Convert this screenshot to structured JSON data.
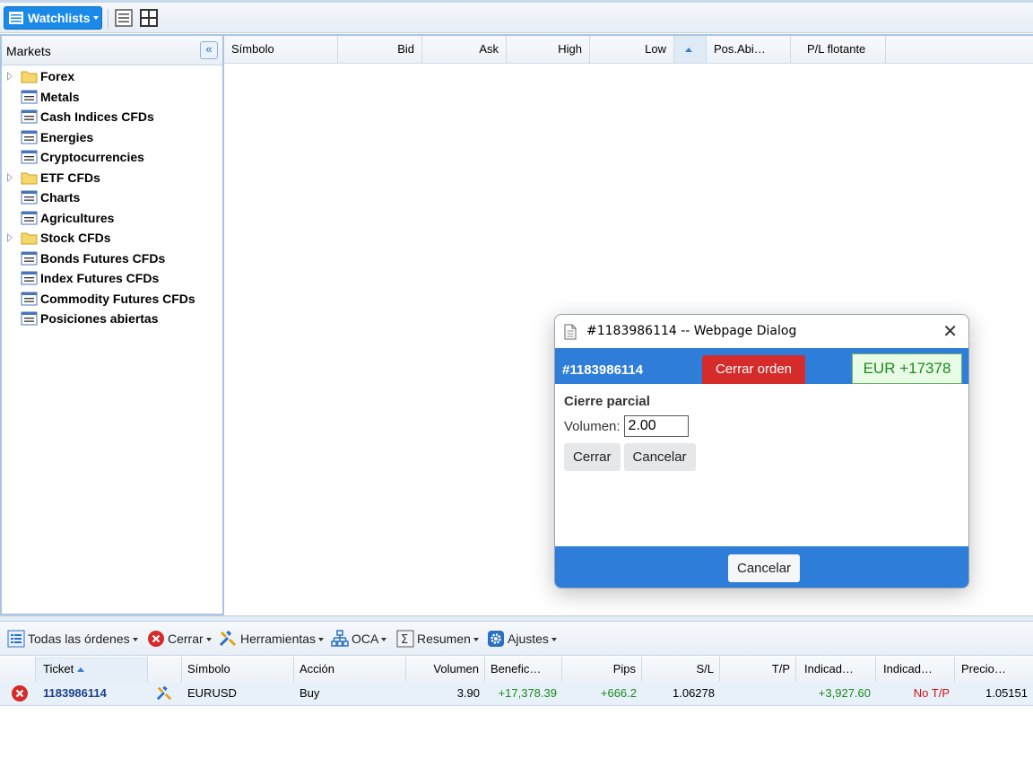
{
  "toolbar": {
    "watchlists_label": "Watchlists",
    "colors": {
      "accent": "#1a8ae8"
    }
  },
  "markets": {
    "title": "Markets",
    "items": [
      {
        "label": "Forex",
        "type": "folder"
      },
      {
        "label": "Metals",
        "type": "list"
      },
      {
        "label": "Cash Indices CFDs",
        "type": "list"
      },
      {
        "label": "Energies",
        "type": "list"
      },
      {
        "label": "Cryptocurrencies",
        "type": "list"
      },
      {
        "label": "ETF CFDs",
        "type": "folder"
      },
      {
        "label": "Charts",
        "type": "list"
      },
      {
        "label": "Agricultures",
        "type": "list"
      },
      {
        "label": "Stock CFDs",
        "type": "folder"
      },
      {
        "label": "Bonds Futures CFDs",
        "type": "list"
      },
      {
        "label": "Index Futures CFDs",
        "type": "list"
      },
      {
        "label": "Commodity Futures CFDs",
        "type": "list"
      },
      {
        "label": "Posiciones abiertas",
        "type": "list"
      }
    ]
  },
  "grid": {
    "columns": [
      "Símbolo",
      "Bid",
      "Ask",
      "High",
      "Low",
      "",
      "Pos.Abi…",
      "P/L flotante"
    ]
  },
  "orders_toolbar": {
    "all_orders": "Todas las órdenes",
    "close": "Cerrar",
    "tools": "Herramientas",
    "oca": "OCA",
    "summary": "Resumen",
    "settings": "Ajustes"
  },
  "orders": {
    "columns": [
      "Ticket",
      "",
      "Símbolo",
      "Acción",
      "Volumen",
      "Benefic…",
      "Pips",
      "S/L",
      "T/P",
      "Indicad…",
      "Indicad…",
      "Precio…"
    ],
    "row": {
      "ticket": "1183986114",
      "symbol": "EURUSD",
      "action": "Buy",
      "volume": "3.90",
      "profit": "+17,378.39",
      "pips": "+666.2",
      "sl": "1.06278",
      "tp": "",
      "ind1": "+3,927.60",
      "ind2": "No T/P",
      "price": "1.05151"
    }
  },
  "dialog": {
    "title": "#1183986114 -- Webpage Dialog",
    "ticket": "#1183986114",
    "close_order": "Cerrar orden",
    "pl": "EUR +17378",
    "partial_heading": "Cierre parcial",
    "volume_label": "Volumen:",
    "volume_value": "2.00",
    "close_btn": "Cerrar",
    "cancel_btn": "Cancelar",
    "footer_cancel": "Cancelar"
  }
}
